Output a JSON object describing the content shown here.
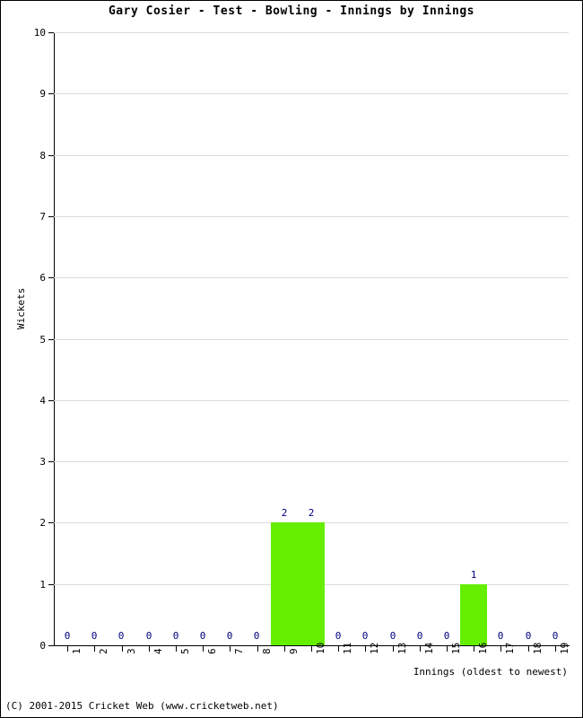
{
  "chart_data": {
    "type": "bar",
    "title": "Gary Cosier - Test - Bowling - Innings by Innings",
    "xlabel": "Innings (oldest to newest)",
    "ylabel": "Wickets",
    "categories": [
      "1",
      "2",
      "3",
      "4",
      "5",
      "6",
      "7",
      "8",
      "9",
      "10",
      "11",
      "12",
      "13",
      "14",
      "15",
      "16",
      "17",
      "18",
      "19"
    ],
    "values": [
      0,
      0,
      0,
      0,
      0,
      0,
      0,
      0,
      2,
      2,
      0,
      0,
      0,
      0,
      0,
      1,
      0,
      0,
      0
    ],
    "value_labels": [
      "0",
      "0",
      "0",
      "0",
      "0",
      "0",
      "0",
      "0",
      "2",
      "2",
      "0",
      "0",
      "0",
      "0",
      "0",
      "1",
      "0",
      "0",
      "0"
    ],
    "ylim": [
      0,
      10
    ],
    "yticks": [
      0,
      1,
      2,
      3,
      4,
      5,
      6,
      7,
      8,
      9,
      10
    ],
    "ytick_labels": [
      "0",
      "1",
      "2",
      "3",
      "4",
      "5",
      "6",
      "7",
      "8",
      "9",
      "10"
    ],
    "grid": true,
    "legend": false,
    "bar_color": "#66ee00",
    "value_label_color": "#000080",
    "grid_color": "#dcdcdc",
    "axis_color": "#000000"
  },
  "footer": {
    "copyright": "(C) 2001-2015 Cricket Web (www.cricketweb.net)"
  }
}
